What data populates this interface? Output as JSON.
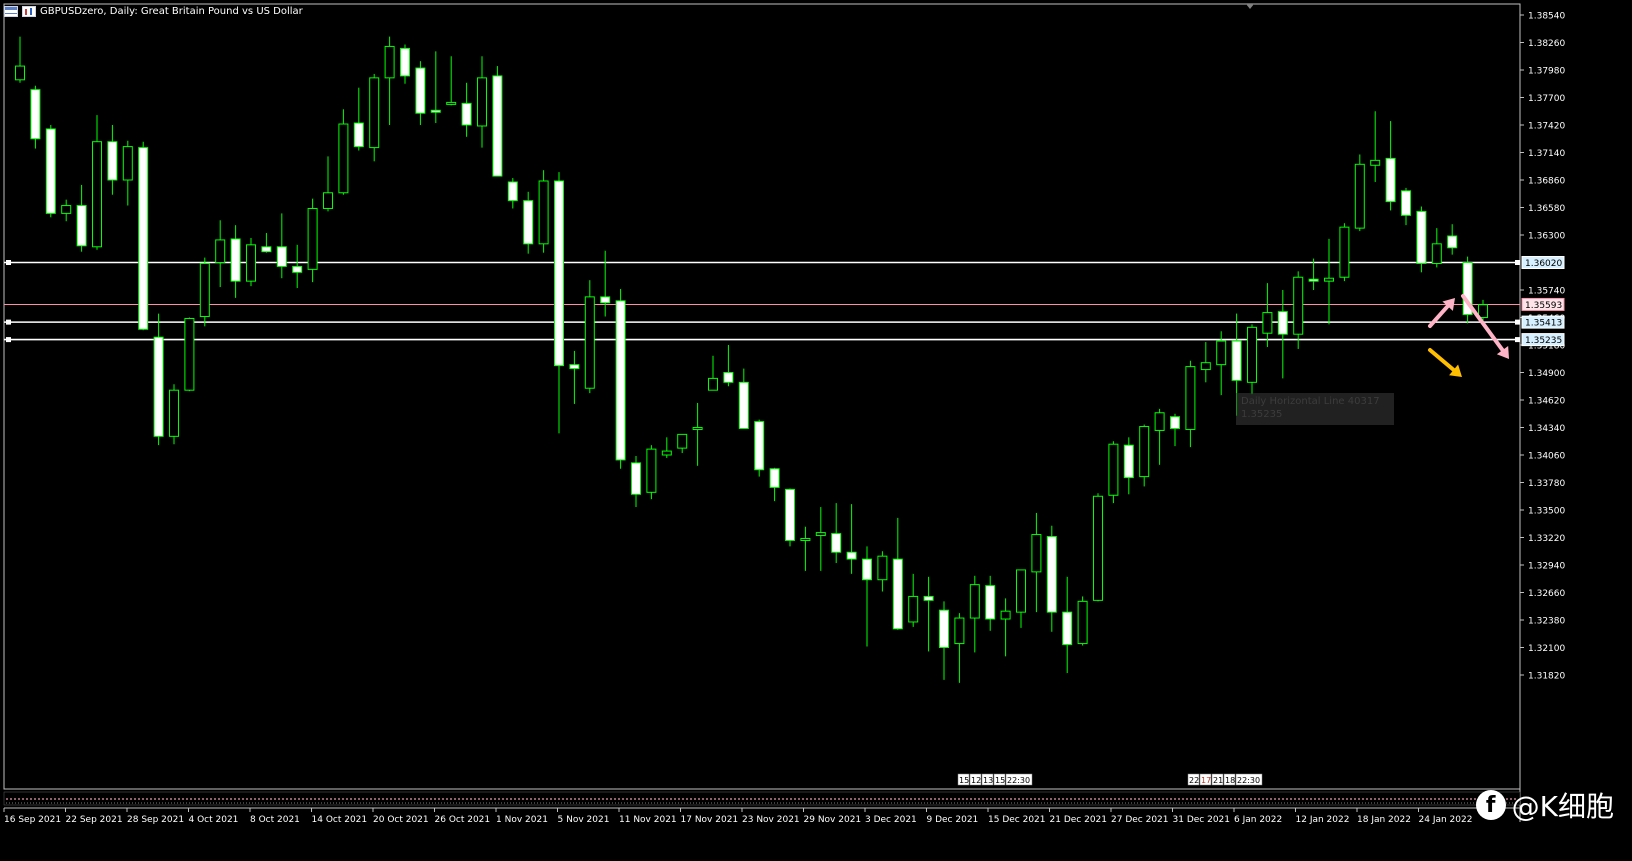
{
  "window": {
    "title": "GBPUSDzero, Daily:  Great Britain Pound vs US Dollar"
  },
  "watermark": {
    "icon": "f",
    "text": "@K细胞"
  },
  "tooltip": {
    "line1": "Daily Horizontal Line 40317",
    "line2": "1.35235"
  },
  "time_markers": {
    "group1": [
      "15:",
      "12:",
      "13:",
      "15:",
      "22:30"
    ],
    "group2": [
      "22:",
      "17:",
      "21:",
      "18:",
      "22:30"
    ]
  },
  "colors": {
    "background": "#000000",
    "bull_candle": "#000000",
    "bear_candle": "#ffffff",
    "wick": "#00ff00",
    "hline": "#ffffff",
    "bid_line": "#ff8fa8",
    "arrow_pink": "#ffb3c6",
    "arrow_orange": "#ffbf00"
  },
  "chart_data": {
    "type": "candlestick",
    "symbol": "GBPUSDzero",
    "timeframe": "Daily",
    "ylim": [
      1.3168,
      1.3868
    ],
    "y_ticks": [
      "1.38540",
      "1.38260",
      "1.37980",
      "1.37700",
      "1.37420",
      "1.37140",
      "1.36860",
      "1.36580",
      "1.36300",
      "1.35740",
      "1.35460",
      "1.35180",
      "1.34900",
      "1.34620",
      "1.34340",
      "1.34060",
      "1.33780",
      "1.33500",
      "1.33220",
      "1.32940",
      "1.32660",
      "1.32380",
      "1.32100",
      "1.31820"
    ],
    "x_labels": [
      "16 Sep 2021",
      "22 Sep 2021",
      "28 Sep 2021",
      "4 Oct 2021",
      "8 Oct 2021",
      "14 Oct 2021",
      "20 Oct 2021",
      "26 Oct 2021",
      "1 Nov 2021",
      "5 Nov 2021",
      "11 Nov 2021",
      "17 Nov 2021",
      "23 Nov 2021",
      "29 Nov 2021",
      "3 Dec 2021",
      "9 Dec 2021",
      "15 Dec 2021",
      "21 Dec 2021",
      "27 Dec 2021",
      "31 Dec 2021",
      "6 Jan 2022",
      "12 Jan 2022",
      "18 Jan 2022",
      "24 Jan 2022"
    ],
    "horizontal_lines": [
      {
        "price": 1.3602,
        "label": "1.36020"
      },
      {
        "price": 1.35593,
        "label": "1.35593",
        "bid": true
      },
      {
        "price": 1.35413,
        "label": "1.35413"
      },
      {
        "price": 1.35235,
        "label": "1.35235"
      }
    ],
    "candles": [
      [
        1.3788,
        1.3832,
        1.3785,
        1.3802
      ],
      [
        1.3778,
        1.3782,
        1.3718,
        1.3728
      ],
      [
        1.3738,
        1.3742,
        1.3648,
        1.3652
      ],
      [
        1.3652,
        1.3666,
        1.3644,
        1.366
      ],
      [
        1.366,
        1.3681,
        1.3613,
        1.3619
      ],
      [
        1.3618,
        1.3752,
        1.3615,
        1.3725
      ],
      [
        1.3725,
        1.3742,
        1.3671,
        1.3686
      ],
      [
        1.3686,
        1.3726,
        1.366,
        1.372
      ],
      [
        1.3719,
        1.3725,
        1.3533,
        1.3534
      ],
      [
        1.3526,
        1.355,
        1.3416,
        1.3425
      ],
      [
        1.3425,
        1.3478,
        1.3417,
        1.3472
      ],
      [
        1.3472,
        1.3546,
        1.3471,
        1.3545
      ],
      [
        1.3547,
        1.3607,
        1.3537,
        1.3601
      ],
      [
        1.3602,
        1.3645,
        1.3577,
        1.3625
      ],
      [
        1.3626,
        1.364,
        1.3566,
        1.3583
      ],
      [
        1.3583,
        1.3627,
        1.3578,
        1.362
      ],
      [
        1.3618,
        1.3632,
        1.3612,
        1.3613
      ],
      [
        1.3618,
        1.3652,
        1.3586,
        1.3598
      ],
      [
        1.3598,
        1.362,
        1.3576,
        1.3592
      ],
      [
        1.3595,
        1.3667,
        1.3582,
        1.3657
      ],
      [
        1.3657,
        1.371,
        1.3654,
        1.3673
      ],
      [
        1.3673,
        1.3758,
        1.3671,
        1.3743
      ],
      [
        1.3744,
        1.378,
        1.3716,
        1.372
      ],
      [
        1.3719,
        1.3794,
        1.3705,
        1.379
      ],
      [
        1.379,
        1.3832,
        1.3742,
        1.3822
      ],
      [
        1.382,
        1.3824,
        1.3784,
        1.3792
      ],
      [
        1.38,
        1.3807,
        1.3742,
        1.3754
      ],
      [
        1.3757,
        1.3817,
        1.3744,
        1.3755
      ],
      [
        1.3764,
        1.3812,
        1.3762,
        1.3765
      ],
      [
        1.3764,
        1.3785,
        1.373,
        1.3742
      ],
      [
        1.3741,
        1.3812,
        1.3719,
        1.379
      ],
      [
        1.3792,
        1.3802,
        1.3697,
        1.369
      ],
      [
        1.3684,
        1.3688,
        1.3657,
        1.3665
      ],
      [
        1.3665,
        1.3674,
        1.3611,
        1.3621
      ],
      [
        1.3621,
        1.3696,
        1.3612,
        1.3685
      ],
      [
        1.3685,
        1.3694,
        1.3428,
        1.3497
      ],
      [
        1.3498,
        1.3512,
        1.3458,
        1.3494
      ],
      [
        1.3474,
        1.3584,
        1.3469,
        1.3567
      ],
      [
        1.3567,
        1.3614,
        1.3547,
        1.3561
      ],
      [
        1.3563,
        1.3575,
        1.3392,
        1.3401
      ],
      [
        1.3398,
        1.3405,
        1.3353,
        1.3366
      ],
      [
        1.3368,
        1.3416,
        1.3361,
        1.3412
      ],
      [
        1.3406,
        1.3424,
        1.3403,
        1.341
      ],
      [
        1.3413,
        1.3426,
        1.3408,
        1.3427
      ],
      [
        1.3433,
        1.3459,
        1.3395,
        1.3434
      ],
      [
        1.3472,
        1.3507,
        1.3477,
        1.3484
      ],
      [
        1.349,
        1.3518,
        1.3476,
        1.348
      ],
      [
        1.348,
        1.3494,
        1.3435,
        1.3433
      ],
      [
        1.344,
        1.3442,
        1.3384,
        1.3391
      ],
      [
        1.3392,
        1.3393,
        1.3359,
        1.3373
      ],
      [
        1.3371,
        1.3372,
        1.3313,
        1.3319
      ],
      [
        1.3321,
        1.3333,
        1.3288,
        1.3321
      ],
      [
        1.3324,
        1.3353,
        1.3288,
        1.3327
      ],
      [
        1.3326,
        1.3357,
        1.3296,
        1.3307
      ],
      [
        1.3307,
        1.3356,
        1.3285,
        1.33
      ],
      [
        1.33,
        1.3313,
        1.3211,
        1.3279
      ],
      [
        1.3279,
        1.3308,
        1.3267,
        1.3303
      ],
      [
        1.33,
        1.3342,
        1.3228,
        1.3229
      ],
      [
        1.3236,
        1.3285,
        1.3231,
        1.3262
      ],
      [
        1.3262,
        1.3282,
        1.3206,
        1.3258
      ],
      [
        1.3248,
        1.3257,
        1.3177,
        1.321
      ],
      [
        1.3214,
        1.3245,
        1.3174,
        1.324
      ],
      [
        1.324,
        1.3283,
        1.3205,
        1.3274
      ],
      [
        1.3273,
        1.3283,
        1.3227,
        1.3239
      ],
      [
        1.3239,
        1.326,
        1.3201,
        1.3247
      ],
      [
        1.3246,
        1.3287,
        1.323,
        1.3289
      ],
      [
        1.3287,
        1.3347,
        1.3246,
        1.3325
      ],
      [
        1.3323,
        1.3334,
        1.3226,
        1.3246
      ],
      [
        1.3246,
        1.3282,
        1.3184,
        1.3213
      ],
      [
        1.3214,
        1.3262,
        1.3212,
        1.3257
      ],
      [
        1.3258,
        1.3367,
        1.3257,
        1.3364
      ],
      [
        1.3365,
        1.342,
        1.3357,
        1.3417
      ],
      [
        1.3416,
        1.3424,
        1.3366,
        1.3383
      ],
      [
        1.3384,
        1.3437,
        1.3374,
        1.3435
      ],
      [
        1.3431,
        1.3453,
        1.3396,
        1.3449
      ],
      [
        1.3445,
        1.3448,
        1.3415,
        1.3433
      ],
      [
        1.3432,
        1.3502,
        1.3414,
        1.3496
      ],
      [
        1.3493,
        1.3521,
        1.348,
        1.35
      ],
      [
        1.3498,
        1.3532,
        1.3467,
        1.3522
      ],
      [
        1.3522,
        1.355,
        1.3446,
        1.3482
      ],
      [
        1.348,
        1.3539,
        1.3468,
        1.3536
      ],
      [
        1.353,
        1.3581,
        1.3516,
        1.3551
      ],
      [
        1.3552,
        1.3574,
        1.3484,
        1.3529
      ],
      [
        1.3529,
        1.3593,
        1.3514,
        1.3587
      ],
      [
        1.3585,
        1.3606,
        1.3574,
        1.3583
      ],
      [
        1.3583,
        1.3626,
        1.3539,
        1.3586
      ],
      [
        1.3587,
        1.3642,
        1.3583,
        1.3638
      ],
      [
        1.3637,
        1.3712,
        1.3634,
        1.3702
      ],
      [
        1.3701,
        1.3756,
        1.3684,
        1.3706
      ],
      [
        1.3708,
        1.3746,
        1.3655,
        1.3664
      ],
      [
        1.3675,
        1.3678,
        1.364,
        1.365
      ],
      [
        1.3654,
        1.3659,
        1.3592,
        1.3601
      ],
      [
        1.3601,
        1.3637,
        1.3597,
        1.3621
      ],
      [
        1.3629,
        1.3641,
        1.361,
        1.3617
      ],
      [
        1.3602,
        1.3608,
        1.354,
        1.3549
      ],
      [
        1.3546,
        1.3564,
        1.3541,
        1.3559
      ]
    ]
  }
}
